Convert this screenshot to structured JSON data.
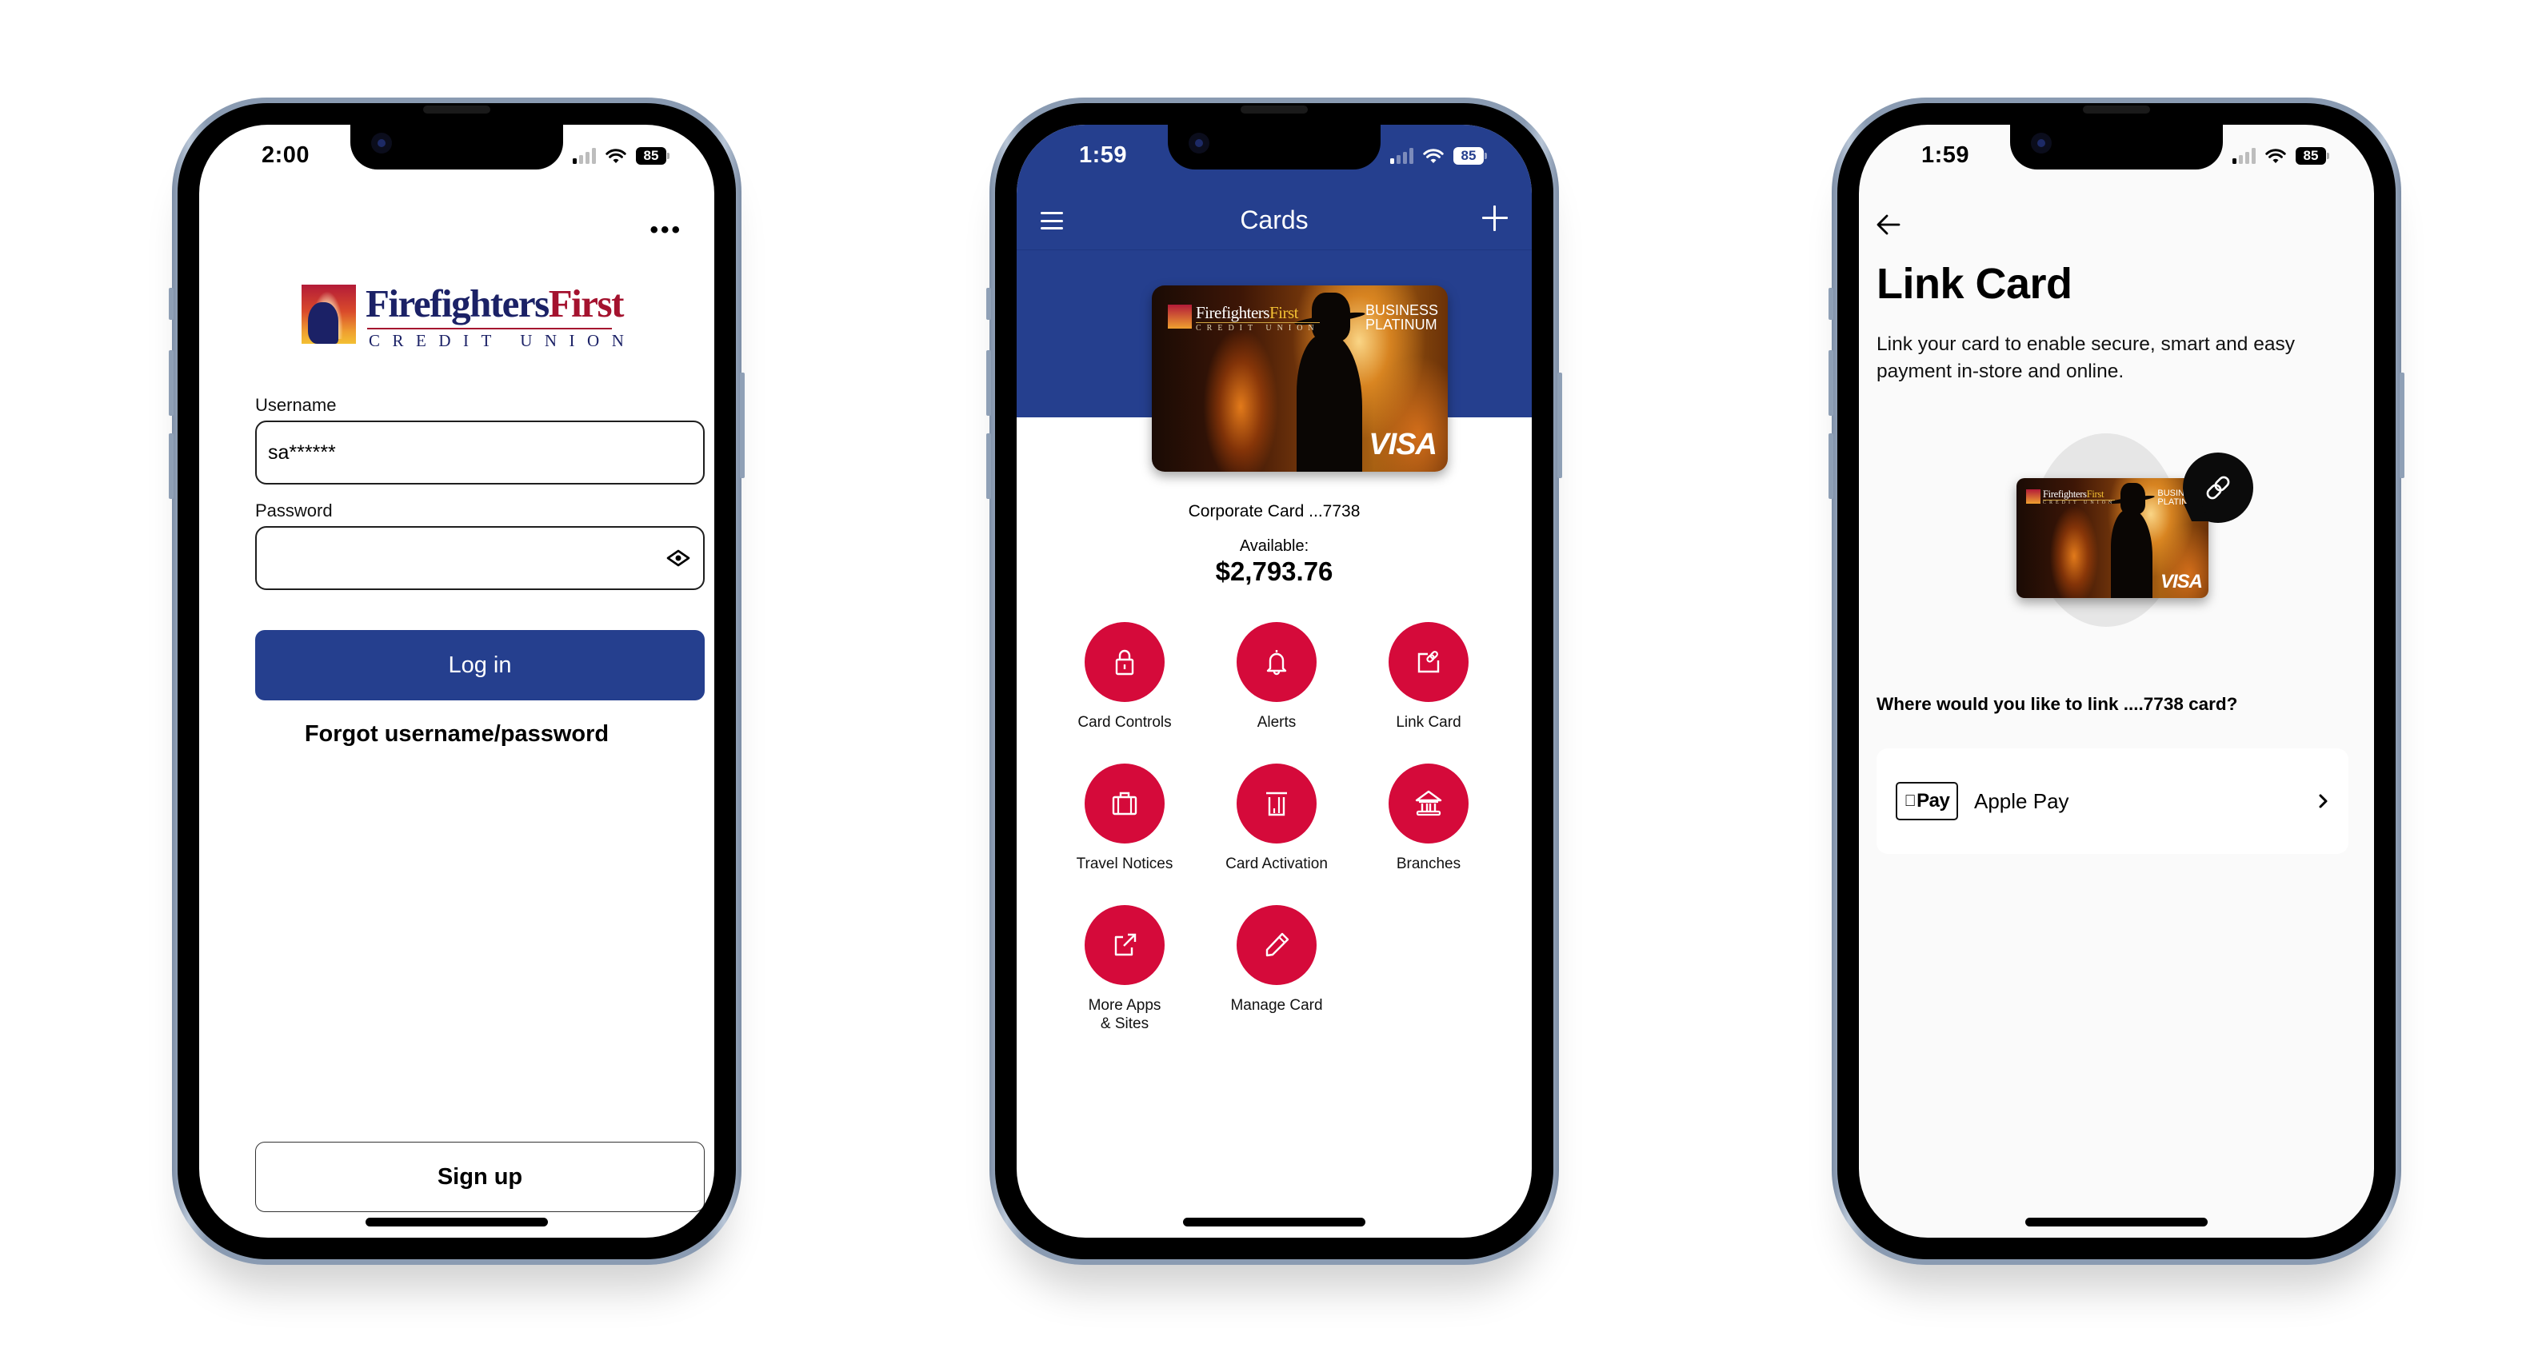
{
  "colors": {
    "brand_blue": "#253f8e",
    "action_red": "#d50a3a",
    "logo_navy": "#1b2166",
    "logo_red": "#a4122e"
  },
  "phones": {
    "login": {
      "status_bar": {
        "time": "2:00",
        "battery": "85",
        "signal_bars_active": 1,
        "signal_bars_total": 4
      },
      "more_menu_icon": "more-horizontal-icon",
      "logo": {
        "name_part1": "Firefighters",
        "name_part2": "First",
        "subtitle": "CREDIT UNION"
      },
      "username": {
        "label": "Username",
        "value": "sa******"
      },
      "password": {
        "label": "Password",
        "value": "",
        "toggle_icon": "eye-icon"
      },
      "login_button": "Log in",
      "forgot_link": "Forgot username/password",
      "signup_button": "Sign up"
    },
    "cards": {
      "status_bar": {
        "time": "1:59",
        "battery": "85",
        "signal_bars_active": 1,
        "signal_bars_total": 4
      },
      "header": {
        "title": "Cards",
        "menu_icon": "hamburger-icon",
        "add_icon": "plus-icon"
      },
      "card": {
        "brand_part1": "Firefighters",
        "brand_part2": "First",
        "brand_subtitle": "CREDIT UNION",
        "tier_line1": "BUSINESS",
        "tier_line2": "PLATINUM",
        "network": "VISA"
      },
      "card_name": "Corporate Card ...7738",
      "available_label": "Available:",
      "available_amount": "$2,793.76",
      "actions": [
        {
          "label": "Card Controls",
          "icon": "lock-icon"
        },
        {
          "label": "Alerts",
          "icon": "bell-icon"
        },
        {
          "label": "Link Card",
          "icon": "link-card-icon"
        },
        {
          "label": "Travel Notices",
          "icon": "suitcase-icon"
        },
        {
          "label": "Card Activation",
          "icon": "card-activation-icon"
        },
        {
          "label": "Branches",
          "icon": "bank-icon"
        },
        {
          "label": "More Apps\n& Sites",
          "icon": "external-link-icon"
        },
        {
          "label": "Manage Card",
          "icon": "pencil-icon"
        }
      ]
    },
    "link_card": {
      "status_bar": {
        "time": "1:59",
        "battery": "85",
        "signal_bars_active": 1,
        "signal_bars_total": 4
      },
      "back_icon": "arrow-left-icon",
      "title": "Link Card",
      "description": "Link your card to enable secure, smart and easy payment in-store and online.",
      "card": {
        "brand_part1": "Firefighters",
        "brand_part2": "First",
        "brand_subtitle": "CREDIT UNION",
        "tier_line1": "BUSINESS",
        "tier_line2": "PLATINUM",
        "network": "VISA"
      },
      "question": "Where would you like to link ....7738 card?",
      "options": [
        {
          "label": "Apple Pay",
          "mark_text": "Pay",
          "mark_icon": "apple-logo-icon",
          "chevron_icon": "chevron-right-icon"
        }
      ]
    }
  }
}
